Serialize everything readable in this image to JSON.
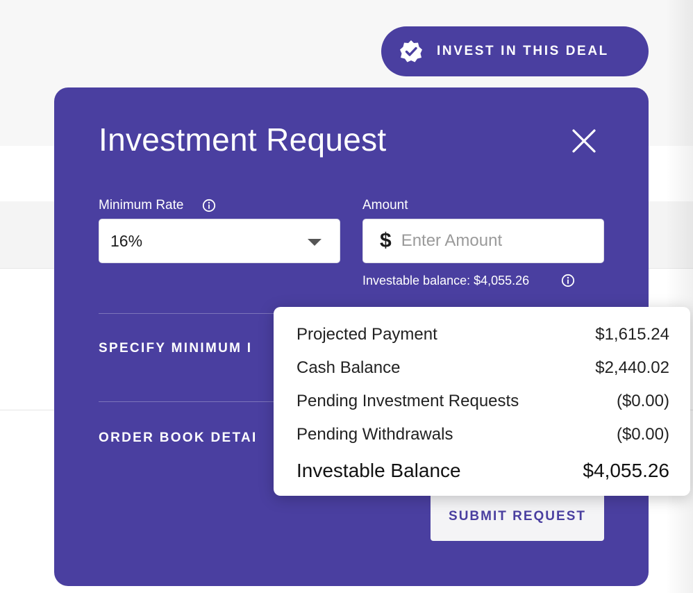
{
  "invest_button": {
    "label": "INVEST IN THIS DEAL",
    "icon": "verified-badge-icon"
  },
  "modal": {
    "title": "Investment Request",
    "close_icon": "close-icon",
    "minimum_rate": {
      "label": "Minimum Rate",
      "value": "16%"
    },
    "amount": {
      "label": "Amount",
      "currency_symbol": "$",
      "placeholder": "Enter Amount"
    },
    "investable_balance_note": "Investable balance: $4,055.26",
    "sections": [
      {
        "label": "SPECIFY MINIMUM I"
      },
      {
        "label": "ORDER BOOK DETAI"
      }
    ],
    "submit_label": "SUBMIT REQUEST"
  },
  "tooltip": {
    "rows": [
      {
        "label": "Projected Payment",
        "value": "$1,615.24"
      },
      {
        "label": "Cash Balance",
        "value": "$2,440.02"
      },
      {
        "label": "Pending Investment Requests",
        "value": "($0.00)"
      },
      {
        "label": "Pending Withdrawals",
        "value": "($0.00)"
      }
    ],
    "total": {
      "label": "Investable Balance",
      "value": "$4,055.26"
    }
  },
  "colors": {
    "primary": "#4a3fa0",
    "white": "#ffffff",
    "submit_bg": "#f4f4f6"
  }
}
